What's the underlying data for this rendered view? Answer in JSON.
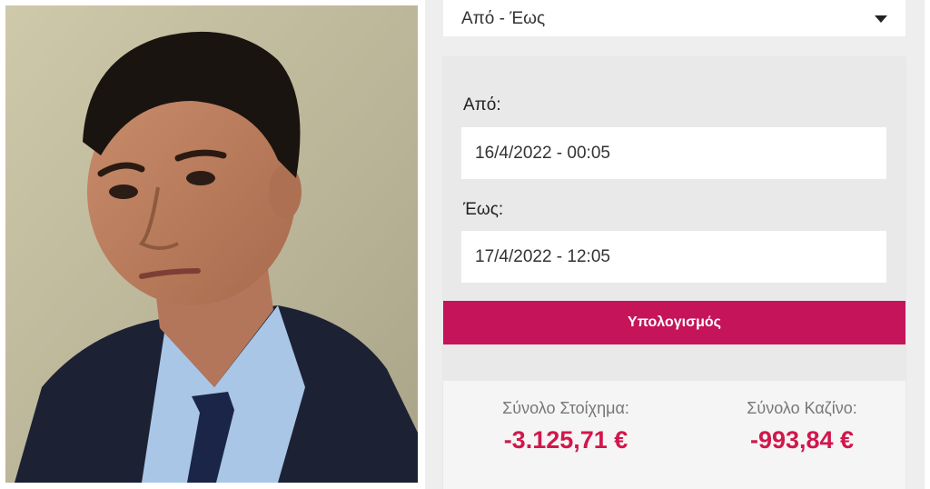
{
  "app": {
    "range_select": {
      "label": "Από - Έως"
    },
    "from": {
      "label": "Από:",
      "value": "16/4/2022 - 00:05"
    },
    "to": {
      "label": "Έως:",
      "value": "17/4/2022 - 12:05"
    },
    "calculate_button": "Υπολογισμός",
    "results": {
      "betting_label": "Σύνολο Στοίχημα:",
      "betting_value": "-3.125,71 €",
      "casino_label": "Σύνολο Καζίνο:",
      "casino_value": "-993,84 €"
    }
  },
  "colors": {
    "accent": "#c5145a",
    "negative_value": "#d1174b"
  },
  "icons": {
    "dropdown": "caret-down-icon"
  }
}
